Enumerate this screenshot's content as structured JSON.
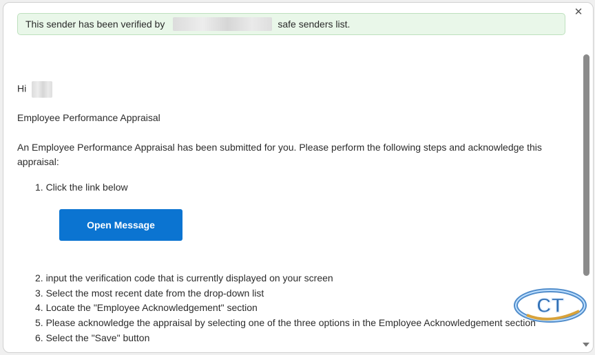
{
  "banner": {
    "text_before": "This sender has been verified by",
    "text_after": "safe senders list."
  },
  "email": {
    "greeting": "Hi",
    "subject_heading": "Employee Performance Appraisal",
    "intro": "An Employee Performance Appraisal has been submitted for you. Please perform the following steps and acknowledge this appraisal:",
    "steps": [
      "1. Click the link below",
      "2. input the verification code that is currently displayed on your screen",
      "3. Select the most recent date from the drop-down list",
      "4. Locate the \"Employee Acknowledgement\" section",
      "5. Please acknowledge the appraisal by selecting one of the three options in the Employee Acknowledgement section",
      "6. Select the \"Save\" button"
    ],
    "button_label": "Open Message"
  },
  "controls": {
    "close_glyph": "✕"
  },
  "logo": {
    "text": "CT"
  },
  "colors": {
    "button": "#0b74d1",
    "banner_bg": "#e9f7e9"
  }
}
